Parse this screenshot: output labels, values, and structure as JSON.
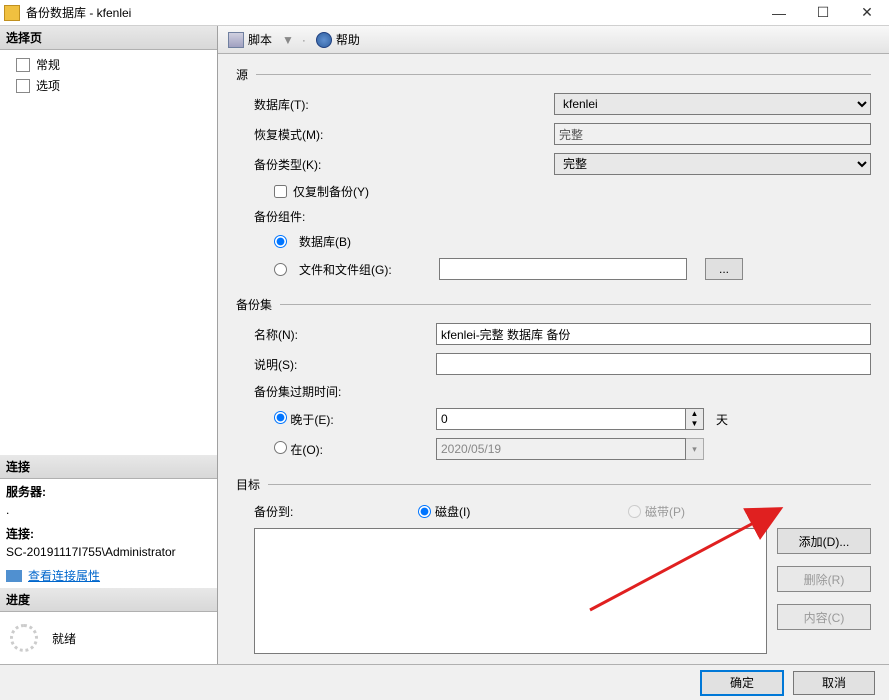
{
  "window": {
    "title": "备份数据库 - kfenlei"
  },
  "left": {
    "select_page": "选择页",
    "nav": {
      "general": "常规",
      "options": "选项"
    },
    "connection_header": "连接",
    "server_label": "服务器:",
    "server_value": ".",
    "conn_label": "连接:",
    "conn_value": "SC-20191117I755\\Administrator",
    "view_conn_props": "查看连接属性",
    "progress_header": "进度",
    "progress_status": "就绪"
  },
  "toolbar": {
    "script": "脚本",
    "dropdown": "▼",
    "help": "帮助"
  },
  "form": {
    "source_legend": "源",
    "database_label": "数据库(T):",
    "database_value": "kfenlei",
    "recovery_label": "恢复模式(M):",
    "recovery_value": "完整",
    "backup_type_label": "备份类型(K):",
    "backup_type_value": "完整",
    "copy_only_label": "仅复制备份(Y)",
    "component_label": "备份组件:",
    "comp_database": "数据库(B)",
    "comp_filegroups": "文件和文件组(G):",
    "browse_dots": "...",
    "backupset_legend": "备份集",
    "name_label": "名称(N):",
    "name_value": "kfenlei-完整 数据库 备份",
    "desc_label": "说明(S):",
    "desc_value": "",
    "expire_label": "备份集过期时间:",
    "expire_after_label": "晚于(E):",
    "expire_after_value": "0",
    "expire_after_unit": "天",
    "expire_on_label": "在(O):",
    "expire_on_value": "2020/05/19",
    "dest_legend": "目标",
    "backup_to_label": "备份到:",
    "dest_disk": "磁盘(I)",
    "dest_tape": "磁带(P)",
    "btn_add": "添加(D)...",
    "btn_remove": "删除(R)",
    "btn_contents": "内容(C)"
  },
  "footer": {
    "ok": "确定",
    "cancel": "取消"
  }
}
